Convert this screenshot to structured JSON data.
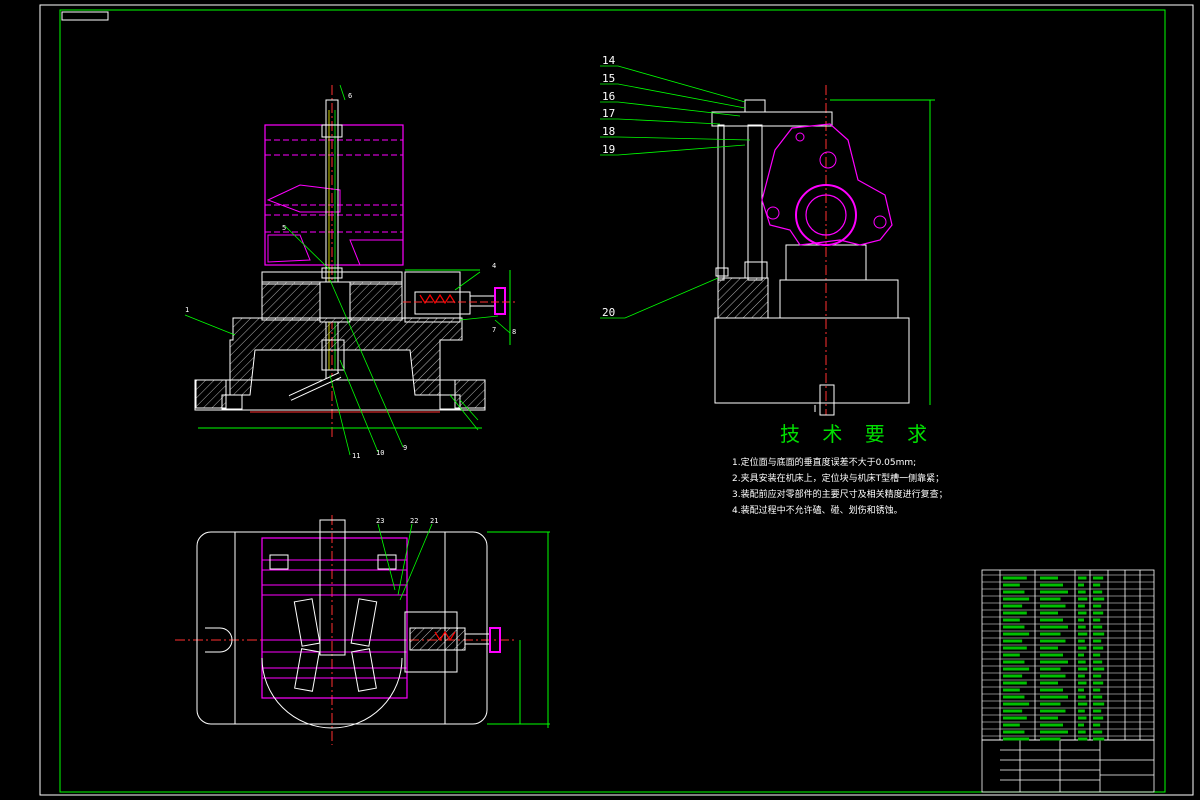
{
  "technical_requirements": {
    "title": "技 术 要 求",
    "items": [
      "1.定位面与底面的垂直度误差不大于0.05mm;",
      "2.夹具安装在机床上，定位块与机床T型槽一侧靠紧；",
      "3.装配前应对零部件的主要尺寸及相关精度进行复查；",
      "4.装配过程中不允许磕、碰、划伤和锈蚀。"
    ]
  },
  "balloons_right": [
    "14",
    "15",
    "16",
    "17",
    "18",
    "19",
    "20"
  ],
  "balloons_left_front": [
    "1",
    "2",
    "3",
    "4",
    "5",
    "6",
    "7",
    "8",
    "9",
    "10",
    "11"
  ],
  "balloons_top_view": [
    "23",
    "22",
    "21"
  ],
  "colors": {
    "frame": "#ffffff",
    "part": "#ff00ff",
    "dim": "#00ff00",
    "hatch": "#ffffff",
    "centerline": "#ff3030",
    "leader": "#00ff00"
  }
}
